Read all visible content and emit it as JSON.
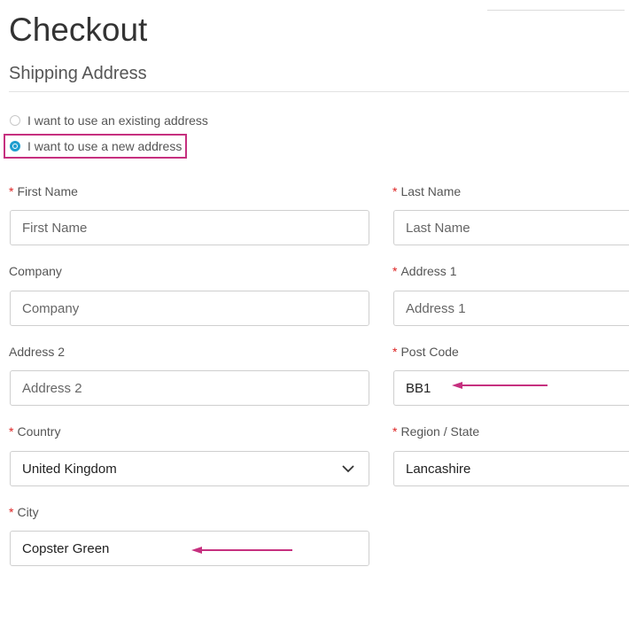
{
  "page": {
    "title": "Checkout",
    "section_title": "Shipping Address"
  },
  "address_choice": {
    "existing_label": "I want to use an existing address",
    "new_label": "I want to use a new address",
    "selected": "new"
  },
  "form": {
    "first_name": {
      "label": "First Name",
      "required": true,
      "placeholder": "First Name",
      "value": ""
    },
    "last_name": {
      "label": "Last Name",
      "required": true,
      "placeholder": "Last Name",
      "value": ""
    },
    "company": {
      "label": "Company",
      "required": false,
      "placeholder": "Company",
      "value": ""
    },
    "address_1": {
      "label": "Address 1",
      "required": true,
      "placeholder": "Address 1",
      "value": ""
    },
    "address_2": {
      "label": "Address 2",
      "required": false,
      "placeholder": "Address 2",
      "value": ""
    },
    "post_code": {
      "label": "Post Code",
      "required": true,
      "placeholder": "",
      "value": "BB1"
    },
    "country": {
      "label": "Country",
      "required": true,
      "value": "United Kingdom"
    },
    "region": {
      "label": "Region / State",
      "required": true,
      "value": "Lancashire"
    },
    "city": {
      "label": "City",
      "required": true,
      "placeholder": "",
      "value": "Copster Green"
    }
  },
  "required_marker": "*",
  "colors": {
    "accent": "#1f9ecf",
    "annotation": "#c6307f",
    "required": "#dd2222"
  }
}
